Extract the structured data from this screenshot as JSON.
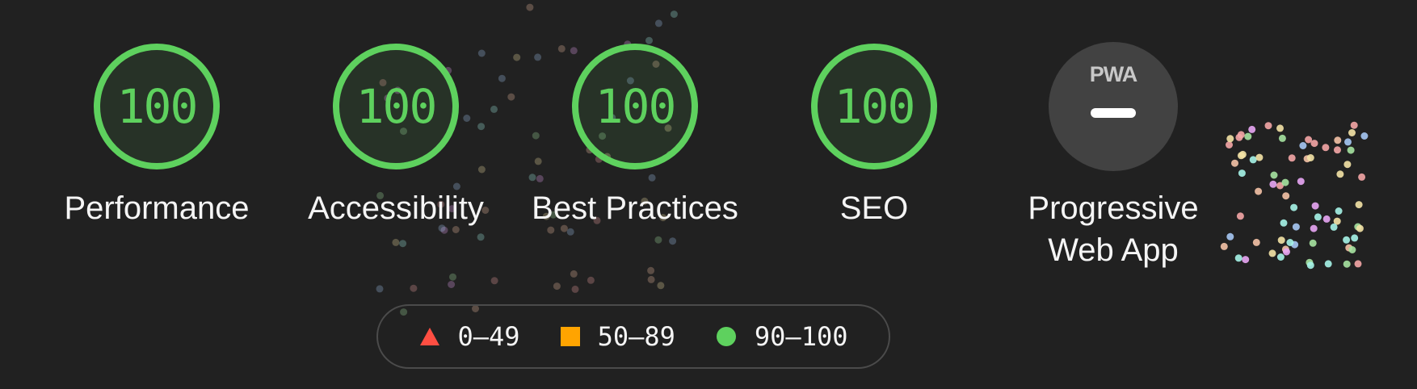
{
  "colors": {
    "background": "#212121",
    "pass": "#5ed15e",
    "average": "#ffa400",
    "fail": "#ff4e42",
    "text": "#f5f5f5",
    "pwa_circle": "#424242"
  },
  "categories": [
    {
      "id": "performance",
      "score": "100",
      "label": "Performance",
      "rating": "pass"
    },
    {
      "id": "accessibility",
      "score": "100",
      "label": "Accessibility",
      "rating": "pass"
    },
    {
      "id": "best-practices",
      "score": "100",
      "label": "Best Practices",
      "rating": "pass"
    },
    {
      "id": "seo",
      "score": "100",
      "label": "SEO",
      "rating": "pass"
    }
  ],
  "pwa": {
    "label_line1": "Progressive",
    "label_line2": "Web App",
    "badge": "PWA",
    "icon": "pwa-logo-icon",
    "status_icon": "dash-icon"
  },
  "legend": [
    {
      "range": "0–49",
      "shape": "triangle",
      "icon": "fail-triangle-icon"
    },
    {
      "range": "50–89",
      "shape": "square",
      "icon": "average-square-icon"
    },
    {
      "range": "90–100",
      "shape": "circle",
      "icon": "pass-circle-icon"
    }
  ]
}
